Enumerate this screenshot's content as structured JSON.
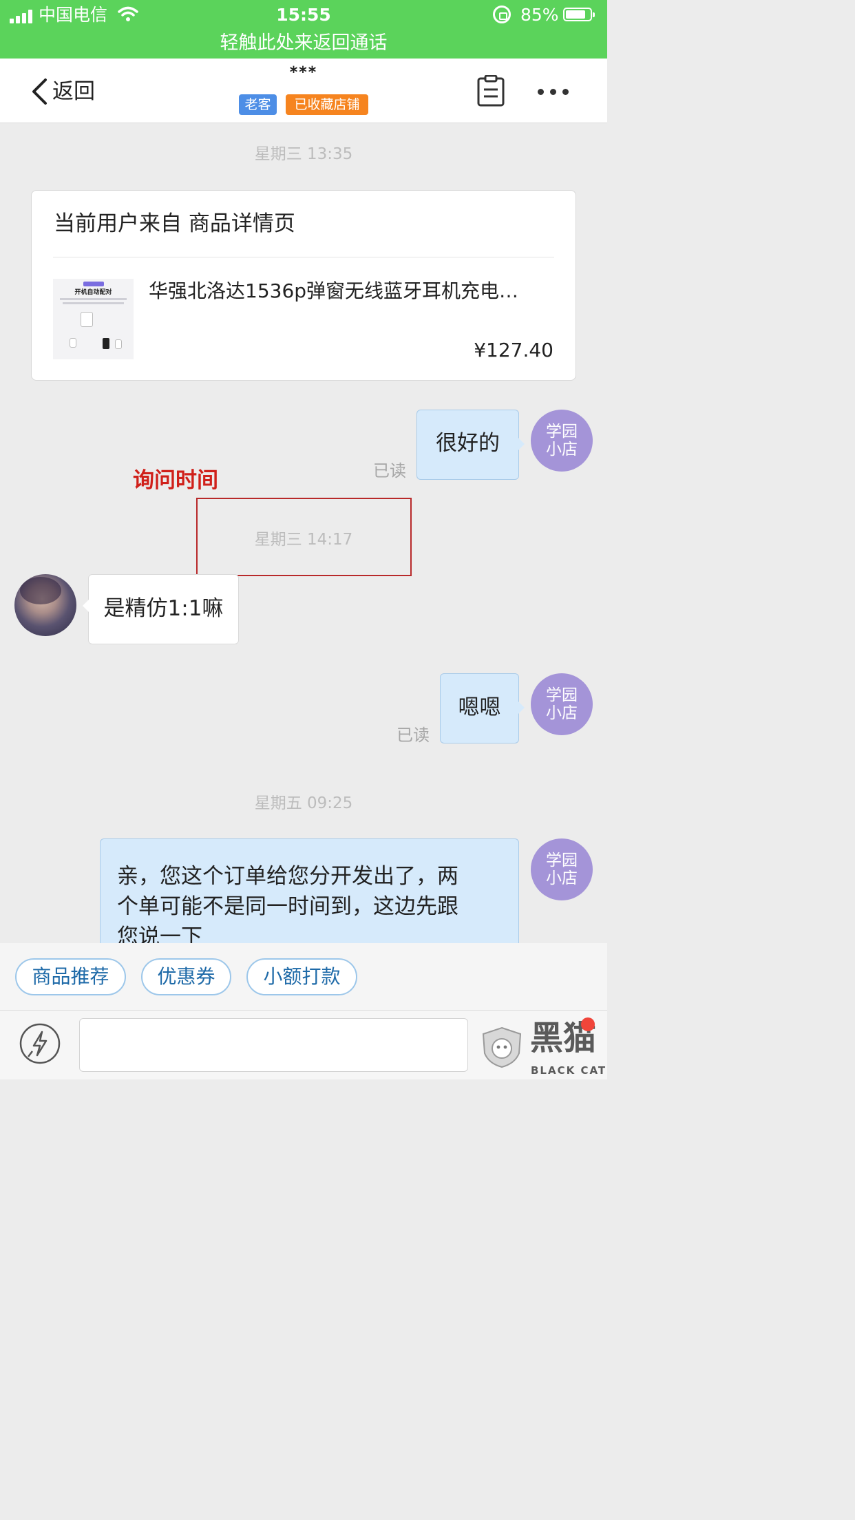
{
  "status_bar": {
    "carrier": "中国电信",
    "time": "15:55",
    "battery": "85%",
    "battery_level": 0.85,
    "call_banner": "轻触此处来返回通话"
  },
  "nav": {
    "back_label": "返回",
    "title": "***",
    "badges": [
      "老客",
      "已收藏店铺"
    ],
    "icons": [
      "chevron-left-icon",
      "clipboard-icon",
      "more-icon"
    ]
  },
  "chat": {
    "timestamps": [
      "星期三 13:35",
      "星期三 14:17",
      "星期五 09:25"
    ],
    "product_card": {
      "source_text": "当前用户来自 商品详情页",
      "product_title": "华强北洛达1536p弹窗无线蓝牙耳机充电…",
      "price": "¥127.40",
      "thumb_heading": "开机自动配对"
    },
    "messages": [
      {
        "side": "right",
        "text": "很好的",
        "status": "已读",
        "avatar": [
          "学园",
          "小店"
        ]
      },
      {
        "side": "left",
        "text": "是精仿1:1嘛"
      },
      {
        "side": "right",
        "text": "嗯嗯",
        "status": "已读",
        "avatar": [
          "学园",
          "小店"
        ]
      },
      {
        "side": "right",
        "text_lines": [
          "亲，您这个订单给您分开发出了，两",
          "个单可能不是同一时间到，这边先跟",
          "您说一下"
        ],
        "avatar": [
          "学园",
          "小店"
        ]
      }
    ]
  },
  "annotation": {
    "label": "询问时间",
    "color": "#d0201a"
  },
  "quick_actions": [
    "商品推荐",
    "优惠券",
    "小额打款"
  ],
  "watermark": {
    "brand": "黑猫",
    "sub": "BLACK CAT"
  },
  "colors": {
    "status_green": "#5bd35b",
    "badge_blue": "#4d8ee6",
    "badge_orange": "#f6841f",
    "avatar_purple": "#a494d8",
    "bubble_blue": "#d6eafb",
    "accent_blue": "#1e6aa8"
  }
}
